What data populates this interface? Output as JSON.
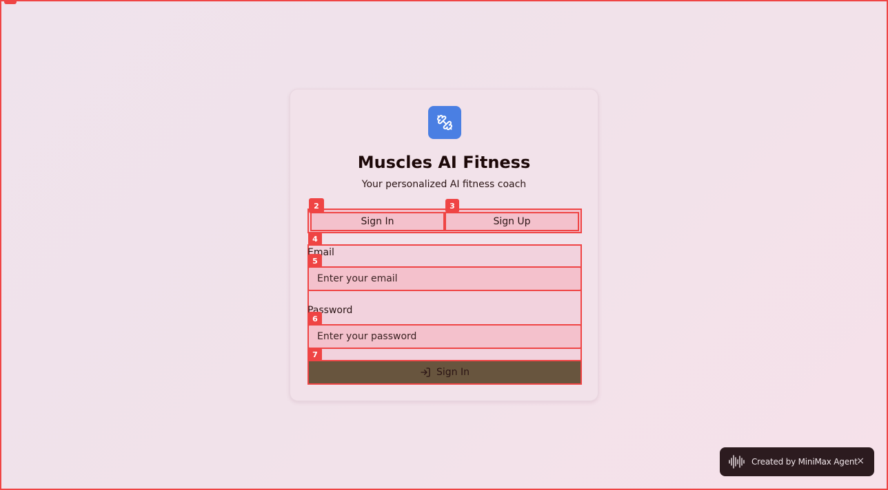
{
  "app": {
    "title": "Muscles AI Fitness",
    "subtitle": "Your personalized AI fitness coach",
    "logo_icon": "dumbbell-icon",
    "accent_color": "#4a7fe3"
  },
  "tabs": [
    {
      "label": "Sign In",
      "badge": "2"
    },
    {
      "label": "Sign Up",
      "badge": "3"
    }
  ],
  "form": {
    "badge": "4",
    "email_label": "Email",
    "email_badge": "5",
    "email_placeholder": "Enter your email",
    "password_label": "Password",
    "password_badge": "6",
    "password_placeholder": "Enter your password",
    "submit_badge": "7",
    "submit_label": "Sign In",
    "submit_icon": "log-in-icon"
  },
  "toast": {
    "text": "Created by MiniMax Agent",
    "icon": "waveform-icon",
    "close_symbol": "×"
  }
}
